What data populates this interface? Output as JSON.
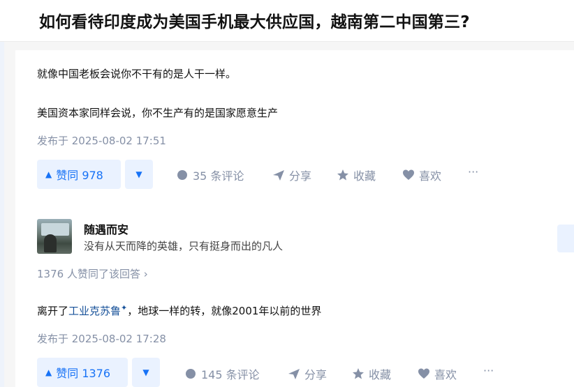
{
  "question": {
    "title": "如何看待印度成为美国手机最大供应国，越南第二中国第三?"
  },
  "answer1": {
    "para1": "就像中国老板会说你不干有的是人干一样。",
    "para2": "美国资本家同样会说，你不生产有的是国家愿意生产",
    "published": "发布于 2025-08-02 17:51",
    "actions": {
      "upvote": "赞同 978",
      "comments": "35 条评论",
      "share": "分享",
      "collect": "收藏",
      "like": "喜欢",
      "more": "···"
    }
  },
  "answer2": {
    "author": {
      "name": "随遇而安",
      "bio": "没有从天而降的英雄，只有挺身而出的凡人"
    },
    "upvote_summary": "1376 人赞同了该回答 ›",
    "content_prefix": "离开了",
    "content_link": "工业克苏鲁",
    "content_suffix": "，地球一样的转，就像2001年以前的世界",
    "published": "发布于 2025-08-02 17:28",
    "actions": {
      "upvote": "赞同 1376",
      "comments": "145 条评论",
      "share": "分享",
      "collect": "收藏",
      "like": "喜欢",
      "more": "···"
    }
  },
  "colors": {
    "accent": "#1772f6",
    "accent_bg": "#eaf2ff",
    "meta": "#8590a6",
    "link": "#175199"
  },
  "icons": [
    "upvote-triangle-icon",
    "downvote-triangle-icon",
    "comment-bubble-icon",
    "share-paper-plane-icon",
    "star-icon",
    "heart-icon",
    "more-dots-icon"
  ]
}
